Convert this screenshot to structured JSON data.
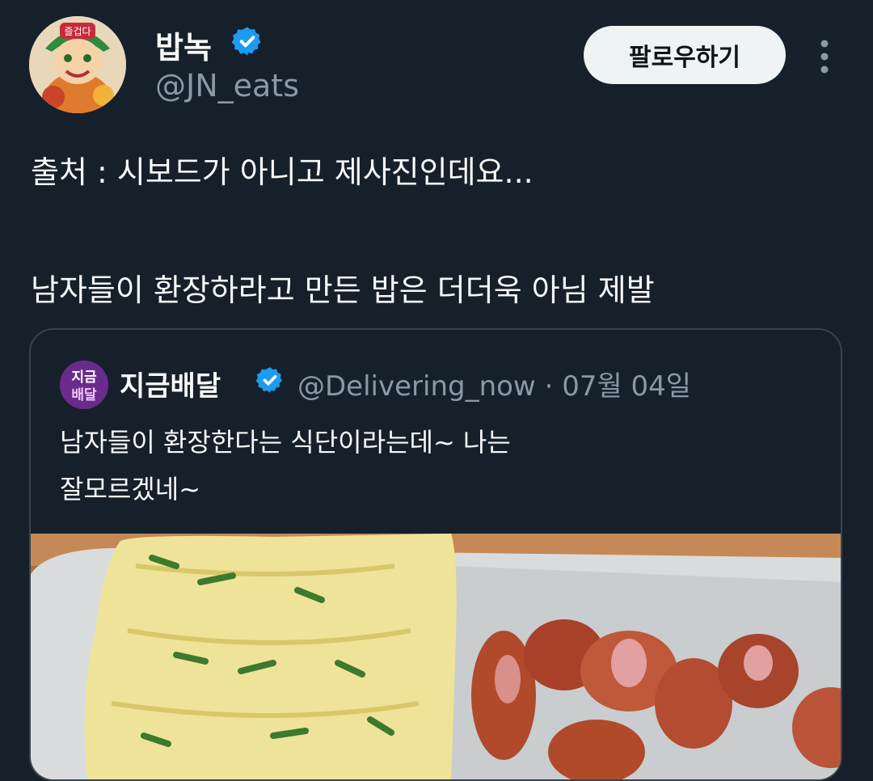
{
  "author": {
    "display_name": "밥녹",
    "handle": "@JN_eats",
    "avatar_text": "즐겁다",
    "verified_icon": "verified-badge-icon"
  },
  "follow_button": {
    "label": "팔로우하기"
  },
  "more_icon": "more-options-icon",
  "tweet": {
    "line1": "출처 : 시보드가 아니고 제사진인데요...",
    "line2": "남자들이 환장하라고 만든 밥은 더더욱 아님 제발"
  },
  "quote": {
    "avatar_text": [
      "지금",
      "배달"
    ],
    "display_name": "지금배달",
    "handle": "@Delivering_now",
    "separator": "·",
    "date": "07월 04일",
    "text_line1": "남자들이 환장한다는 식단이라는데~ 나는",
    "text_line2": "잘모르겠네~"
  },
  "colors": {
    "background": "#15202b",
    "verified": "#1d9bf0",
    "secondary_text": "#8b98a5",
    "border": "#38444d"
  }
}
